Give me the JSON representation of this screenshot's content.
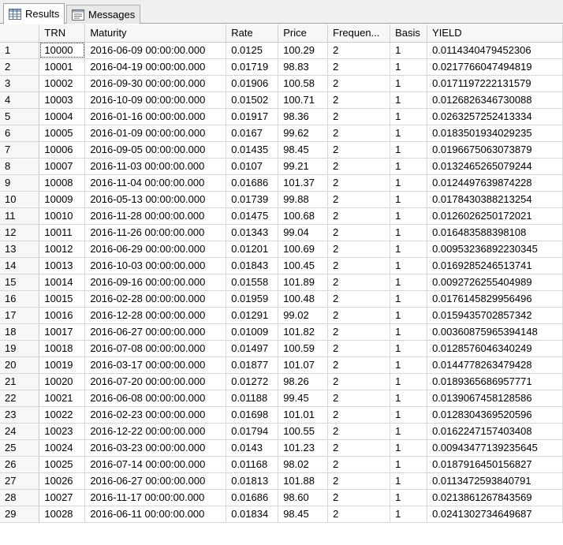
{
  "tabs": [
    {
      "label": "Results",
      "icon": "grid-icon"
    },
    {
      "label": "Messages",
      "icon": "messages-icon"
    }
  ],
  "columns": [
    "",
    "TRN",
    "Maturity",
    "Rate",
    "Price",
    "Frequen...",
    "Basis",
    "YIELD"
  ],
  "rows": [
    [
      "1",
      "10000",
      "2016-06-09 00:00:00.000",
      "0.0125",
      "100.29",
      "2",
      "1",
      "0.0114340479452306"
    ],
    [
      "2",
      "10001",
      "2016-04-19 00:00:00.000",
      "0.01719",
      "98.83",
      "2",
      "1",
      "0.0217766047494819"
    ],
    [
      "3",
      "10002",
      "2016-09-30 00:00:00.000",
      "0.01906",
      "100.58",
      "2",
      "1",
      "0.0171197222131579"
    ],
    [
      "4",
      "10003",
      "2016-10-09 00:00:00.000",
      "0.01502",
      "100.71",
      "2",
      "1",
      "0.0126826346730088"
    ],
    [
      "5",
      "10004",
      "2016-01-16 00:00:00.000",
      "0.01917",
      "98.36",
      "2",
      "1",
      "0.0263257252413334"
    ],
    [
      "6",
      "10005",
      "2016-01-09 00:00:00.000",
      "0.0167",
      "99.62",
      "2",
      "1",
      "0.0183501934029235"
    ],
    [
      "7",
      "10006",
      "2016-09-05 00:00:00.000",
      "0.01435",
      "98.45",
      "2",
      "1",
      "0.0196675063073879"
    ],
    [
      "8",
      "10007",
      "2016-11-03 00:00:00.000",
      "0.0107",
      "99.21",
      "2",
      "1",
      "0.0132465265079244"
    ],
    [
      "9",
      "10008",
      "2016-11-04 00:00:00.000",
      "0.01686",
      "101.37",
      "2",
      "1",
      "0.0124497639874228"
    ],
    [
      "10",
      "10009",
      "2016-05-13 00:00:00.000",
      "0.01739",
      "99.88",
      "2",
      "1",
      "0.0178430388213254"
    ],
    [
      "11",
      "10010",
      "2016-11-28 00:00:00.000",
      "0.01475",
      "100.68",
      "2",
      "1",
      "0.0126026250172021"
    ],
    [
      "12",
      "10011",
      "2016-11-26 00:00:00.000",
      "0.01343",
      "99.04",
      "2",
      "1",
      "0.016483588398108"
    ],
    [
      "13",
      "10012",
      "2016-06-29 00:00:00.000",
      "0.01201",
      "100.69",
      "2",
      "1",
      "0.00953236892230345"
    ],
    [
      "14",
      "10013",
      "2016-10-03 00:00:00.000",
      "0.01843",
      "100.45",
      "2",
      "1",
      "0.0169285246513741"
    ],
    [
      "15",
      "10014",
      "2016-09-16 00:00:00.000",
      "0.01558",
      "101.89",
      "2",
      "1",
      "0.0092726255404989"
    ],
    [
      "16",
      "10015",
      "2016-02-28 00:00:00.000",
      "0.01959",
      "100.48",
      "2",
      "1",
      "0.0176145829956496"
    ],
    [
      "17",
      "10016",
      "2016-12-28 00:00:00.000",
      "0.01291",
      "99.02",
      "2",
      "1",
      "0.0159435702857342"
    ],
    [
      "18",
      "10017",
      "2016-06-27 00:00:00.000",
      "0.01009",
      "101.82",
      "2",
      "1",
      "0.00360875965394148"
    ],
    [
      "19",
      "10018",
      "2016-07-08 00:00:00.000",
      "0.01497",
      "100.59",
      "2",
      "1",
      "0.0128576046340249"
    ],
    [
      "20",
      "10019",
      "2016-03-17 00:00:00.000",
      "0.01877",
      "101.07",
      "2",
      "1",
      "0.0144778263479428"
    ],
    [
      "21",
      "10020",
      "2016-07-20 00:00:00.000",
      "0.01272",
      "98.26",
      "2",
      "1",
      "0.0189365686957771"
    ],
    [
      "22",
      "10021",
      "2016-06-08 00:00:00.000",
      "0.01188",
      "99.45",
      "2",
      "1",
      "0.0139067458128586"
    ],
    [
      "23",
      "10022",
      "2016-02-23 00:00:00.000",
      "0.01698",
      "101.01",
      "2",
      "1",
      "0.0128304369520596"
    ],
    [
      "24",
      "10023",
      "2016-12-22 00:00:00.000",
      "0.01794",
      "100.55",
      "2",
      "1",
      "0.0162247157403408"
    ],
    [
      "25",
      "10024",
      "2016-03-23 00:00:00.000",
      "0.0143",
      "101.23",
      "2",
      "1",
      "0.00943477139235645"
    ],
    [
      "26",
      "10025",
      "2016-07-14 00:00:00.000",
      "0.01168",
      "98.02",
      "2",
      "1",
      "0.0187916450156827"
    ],
    [
      "27",
      "10026",
      "2016-06-27 00:00:00.000",
      "0.01813",
      "101.88",
      "2",
      "1",
      "0.0113472593840791"
    ],
    [
      "28",
      "10027",
      "2016-11-17 00:00:00.000",
      "0.01686",
      "98.60",
      "2",
      "1",
      "0.0213861267843569"
    ],
    [
      "29",
      "10028",
      "2016-06-11 00:00:00.000",
      "0.01834",
      "98.45",
      "2",
      "1",
      "0.0241302734649687"
    ]
  ]
}
